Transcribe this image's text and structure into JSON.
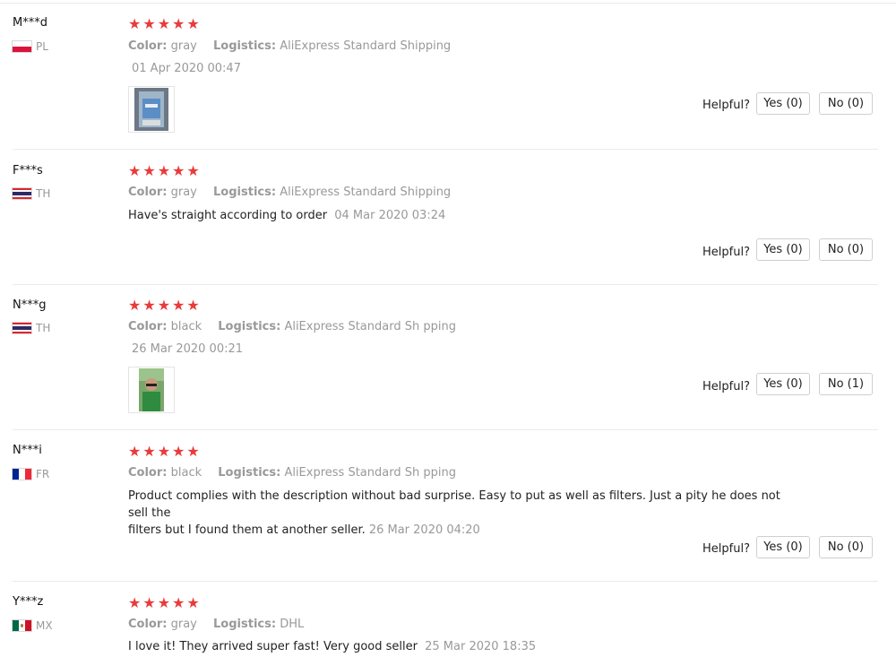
{
  "reviews": [
    {
      "name": "M***d",
      "country": "PL",
      "stars": "★★★★★",
      "color_label": "Color:",
      "color_value": "gray",
      "logistics_label": "Logistics:",
      "logistics_value": "AliExpress Standard Shipping",
      "content": "",
      "date": "01 Apr 2020 00:47",
      "has_photo": true,
      "helpful_label": "Helpful?",
      "yes": "Yes (0)",
      "no": "No (0)"
    },
    {
      "name": "F***s",
      "country": "TH",
      "stars": "★★★★★",
      "color_label": "Color:",
      "color_value": "gray",
      "logistics_label": "Logistics:",
      "logistics_value": "AliExpress Standard Shipping",
      "content": "Have's straight according to order",
      "date": "04 Mar 2020 03:24",
      "has_photo": false,
      "helpful_label": "Helpful?",
      "yes": "Yes (0)",
      "no": "No (0)"
    },
    {
      "name": "N***g",
      "country": "TH",
      "stars": "★★★★★",
      "color_label": "Color:",
      "color_value": "black",
      "logistics_label": "Logistics:",
      "logistics_value": "AliExpress Standard Sh pping",
      "content": "",
      "date": "26 Mar 2020 00:21",
      "has_photo": true,
      "helpful_label": "Helpful?",
      "yes": "Yes (0)",
      "no": "No (1)"
    },
    {
      "name": "N***i",
      "country": "FR",
      "stars": "★★★★★",
      "color_label": "Color:",
      "color_value": "black",
      "logistics_label": "Logistics:",
      "logistics_value": "AliExpress Standard Sh pping",
      "content_line1": "Product complies with the description without bad surprise. Easy to put as well as filters. Just a pity he does not sell the",
      "content_line2": "filters but I found them at another seller.",
      "date": "26 Mar 2020 04:20",
      "has_photo": false,
      "helpful_label": "Helpful?",
      "yes": "Yes (0)",
      "no": "No (0)"
    },
    {
      "name": "Y***z",
      "country": "MX",
      "stars": "★★★★★",
      "color_label": "Color:",
      "color_value": "gray",
      "logistics_label": "Logistics:",
      "logistics_value": "DHL",
      "content": "I love it! They arrived super fast! Very good seller",
      "date": "25 Mar 2020 18:35",
      "has_photo": false
    }
  ],
  "colors": {
    "star": "#e83b3b",
    "muted": "#999999",
    "text": "#222222"
  },
  "icons": {
    "star": "star-icon",
    "thumb_1": "product-photo",
    "thumb_3": "user-photo"
  }
}
